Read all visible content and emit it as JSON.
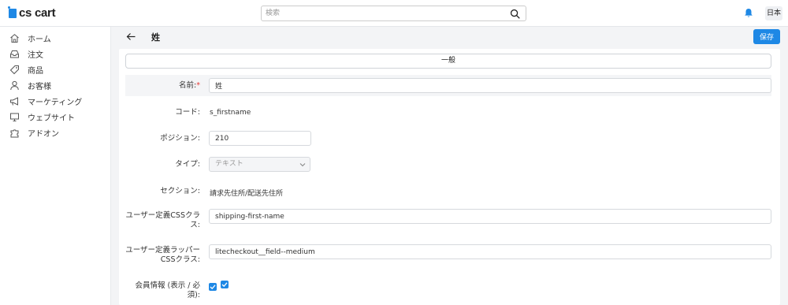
{
  "header": {
    "logo_text": "cs cart",
    "search_placeholder": "検索",
    "language": "日本"
  },
  "sidebar": {
    "items": [
      {
        "label": "ホーム",
        "icon": "home-icon"
      },
      {
        "label": "注文",
        "icon": "inbox-icon"
      },
      {
        "label": "商品",
        "icon": "tag-icon"
      },
      {
        "label": "お客様",
        "icon": "user-icon"
      },
      {
        "label": "マーケティング",
        "icon": "megaphone-icon"
      },
      {
        "label": "ウェブサイト",
        "icon": "monitor-icon"
      },
      {
        "label": "アドオン",
        "icon": "puzzle-icon"
      }
    ]
  },
  "page": {
    "title": "姓",
    "save_label": "保存",
    "tab_label": "一般"
  },
  "form": {
    "name_label": "名前:",
    "name_required_mark": "*",
    "name_value": "姓",
    "code_label": "コード:",
    "code_value": "s_firstname",
    "position_label": "ポジション:",
    "position_value": "210",
    "type_label": "タイプ:",
    "type_value": "テキスト",
    "section_label": "セクション:",
    "section_value": "請求先住所/配送先住所",
    "css_class_label_1": "ユーザー定義CSSクラ",
    "css_class_label_2": "ス:",
    "css_class_value": "shipping-first-name",
    "wrapper_class_label_1": "ユーザー定義ラッパー",
    "wrapper_class_label_2": "CSSクラス:",
    "wrapper_class_value": "litecheckout__field--medium",
    "profile_label": "会員情報 (表示 / 必須):",
    "profile_show": true,
    "profile_required": true
  },
  "colors": {
    "accent": "#1e88e5",
    "required": "#e53935"
  }
}
